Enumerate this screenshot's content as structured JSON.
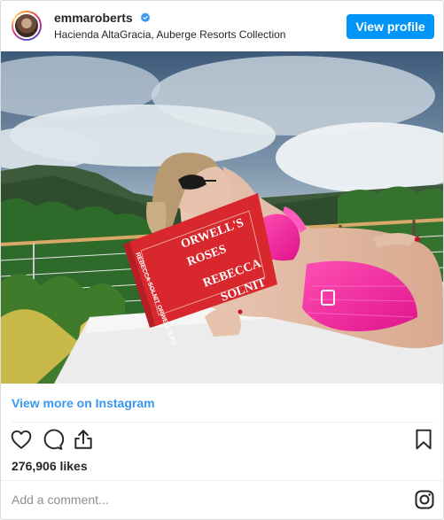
{
  "header": {
    "username": "emmaroberts",
    "location": "Hacienda AltaGracia, Auberge Resorts Collection",
    "view_profile_label": "View profile",
    "verified_icon": "verified-badge-icon"
  },
  "post": {
    "book_title_lines": [
      "ORWELL'S",
      "ROSES",
      "REBECCA",
      "SOLNIT"
    ],
    "book_spine_text": "REBECCA SOLNIT ORWELL'S RO"
  },
  "footer": {
    "view_more_label": "View more on Instagram",
    "likes": "276,906 likes",
    "comment_placeholder": "Add a comment...",
    "icons": [
      "heart-icon",
      "comment-icon",
      "share-icon",
      "bookmark-icon",
      "instagram-icon"
    ]
  },
  "colors": {
    "accent": "#0095f6",
    "link": "#3897f0",
    "text": "#262626",
    "muted": "#8e8e8e",
    "border": "#dbdbdb"
  }
}
